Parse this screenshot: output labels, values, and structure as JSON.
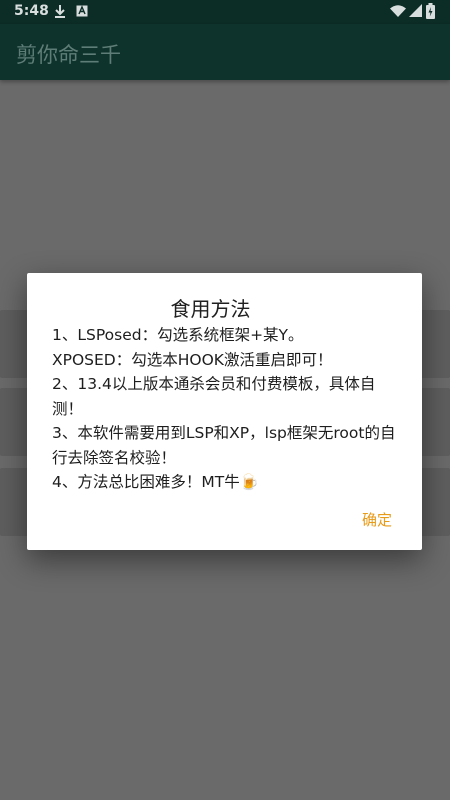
{
  "status_bar": {
    "time": "5:48",
    "icons": [
      "download-icon",
      "notification-a-icon",
      "wifi-icon",
      "signal-icon",
      "battery-icon"
    ]
  },
  "app_bar": {
    "title": "剪你命三千"
  },
  "dialog": {
    "title": "食用方法",
    "lines": [
      "1、LSPosed：勾选系统框架+某Y。",
      "XPOSED：勾选本HOOK激活重启即可！",
      "2、13.4以上版本通杀会员和付费模板，具体自测！",
      "3、本软件需要用到LSP和XP，lsp框架无root的自行去除签名校验！",
      "4、方法总比困难多！MT牛🍺"
    ],
    "confirm_label": "确定"
  },
  "colors": {
    "app_bar": "#0e332c",
    "status_bar": "#0c2c26",
    "accent": "#e89a19",
    "scrim": "#6a6a6a"
  }
}
